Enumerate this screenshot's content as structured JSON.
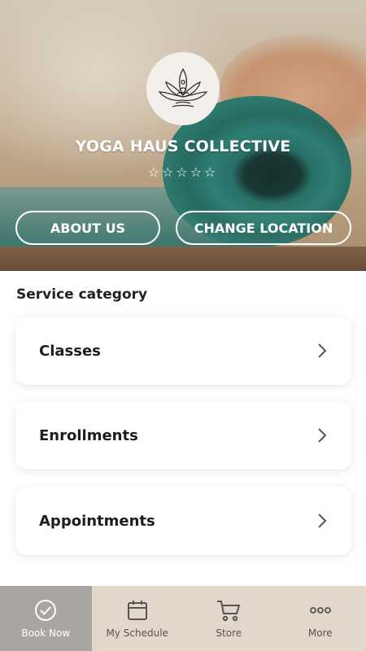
{
  "studio": {
    "name": "YOGA HAUS COLLECTIVE",
    "stars": "☆☆☆☆☆",
    "rating": 0
  },
  "buttons": {
    "about": "ABOUT US",
    "change_location": "CHANGE LOCATION"
  },
  "service": {
    "title": "Service category",
    "items": [
      {
        "label": "Classes"
      },
      {
        "label": "Enrollments"
      },
      {
        "label": "Appointments"
      }
    ]
  },
  "tabbar": {
    "tabs": [
      {
        "label": "Book Now",
        "icon": "check-circle-icon",
        "active": true
      },
      {
        "label": "My Schedule",
        "icon": "calendar-icon",
        "active": false
      },
      {
        "label": "Store",
        "icon": "cart-icon",
        "active": false
      },
      {
        "label": "More",
        "icon": "more-dots-icon",
        "active": false
      }
    ]
  },
  "colors": {
    "active_tab": "#a9a6a2",
    "tabbar_bg": "#e2d7ca",
    "mat_green": "#2f8579"
  }
}
